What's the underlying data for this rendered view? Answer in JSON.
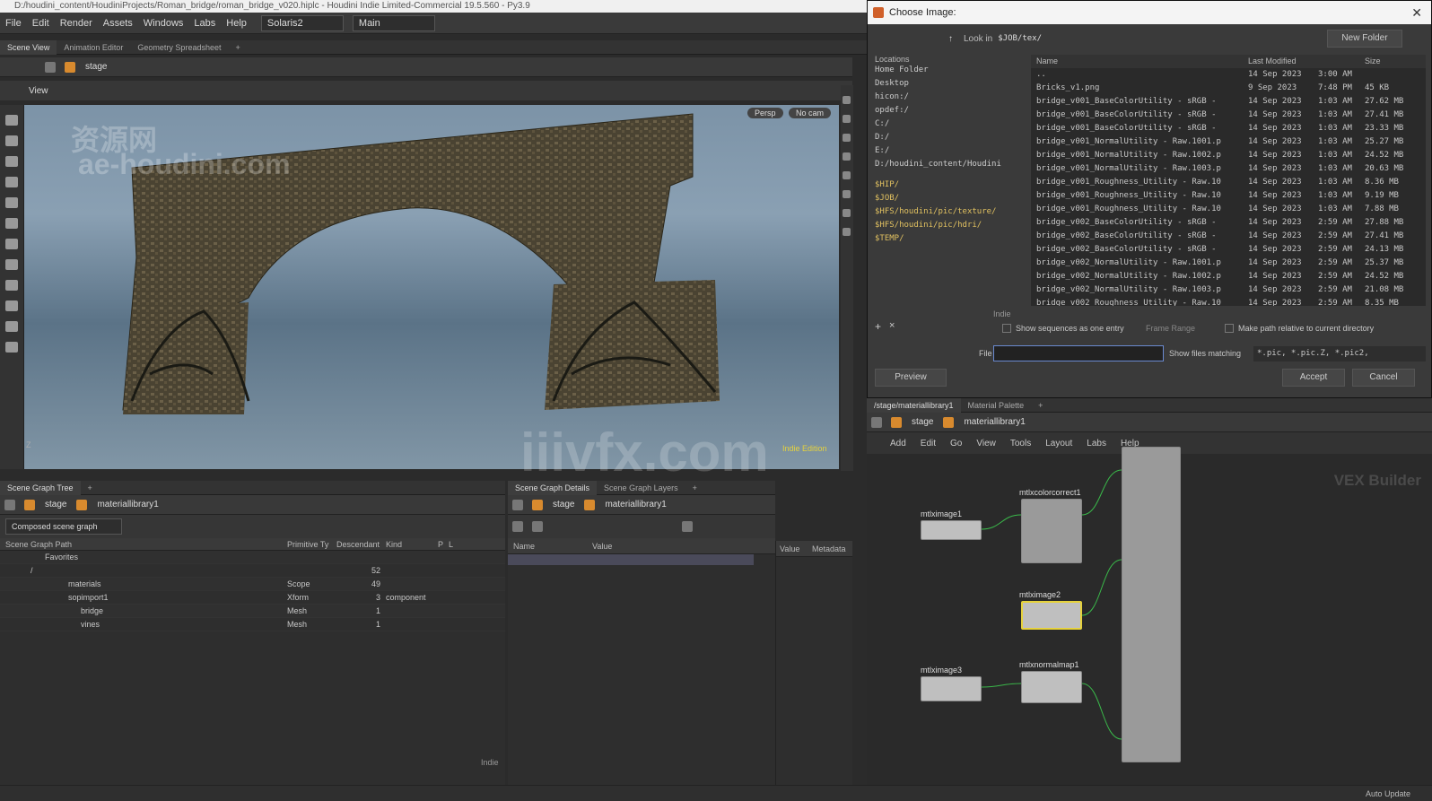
{
  "app": {
    "title": "D:/houdini_content/HoudiniProjects/Roman_bridge/roman_bridge_v020.hiplc - Houdini Indie Limited-Commercial 19.5.560 - Py3.9",
    "menu": [
      "File",
      "Edit",
      "Render",
      "Assets",
      "Windows",
      "Labs",
      "Help"
    ],
    "desktop": "Solaris2",
    "context": "Main"
  },
  "top_tabs": [
    "Scene View",
    "Animation Editor",
    "Geometry Spreadsheet"
  ],
  "stage_path": "stage",
  "viewport": {
    "label": "View",
    "persp": "Persp",
    "cam": "No cam",
    "watermark_top": "资源网",
    "watermark_bottom": "ae-houdini.com",
    "center_watermark": "iiivfx.com",
    "indie_label": "Indie Edition"
  },
  "scene_graph_tree": {
    "tab": "Scene Graph Tree",
    "path_stage": "stage",
    "path_node": "materiallibrary1",
    "mode": "Composed scene graph",
    "columns": [
      "Scene Graph Path",
      "Primitive Ty",
      "Descendant",
      "Kind",
      "P",
      "L"
    ],
    "rows": [
      {
        "name": "Favorites",
        "type": "",
        "desc": "",
        "kind": ""
      },
      {
        "name": "/",
        "type": "",
        "desc": "52",
        "kind": ""
      },
      {
        "name": "materials",
        "type": "Scope",
        "desc": "49",
        "kind": ""
      },
      {
        "name": "sopimport1",
        "type": "Xform",
        "desc": "3",
        "kind": "component"
      },
      {
        "name": "bridge",
        "type": "Mesh",
        "desc": "1",
        "kind": ""
      },
      {
        "name": "vines",
        "type": "Mesh",
        "desc": "1",
        "kind": ""
      }
    ],
    "footer": "Indie"
  },
  "scene_graph_details": {
    "tabs": [
      "Scene Graph Details",
      "Scene Graph Layers"
    ],
    "path_stage": "stage",
    "path_node": "materiallibrary1",
    "col_name": "Name",
    "col_value": "Value",
    "side_value": "Value",
    "side_meta": "Metadata"
  },
  "dialog": {
    "title": "Choose Image:",
    "look_in_label": "Look in",
    "look_in": "$JOB/tex/",
    "new_folder": "New Folder",
    "locations_label": "Locations",
    "locations": [
      "Home Folder",
      "Desktop",
      "hicon:/",
      "opdef:/",
      "C:/",
      "D:/",
      "E:/",
      "D:/houdini_content/Houdini"
    ],
    "folders": [
      "$HIP/",
      "$JOB/",
      "$HFS/houdini/pic/texture/",
      "$HFS/houdini/pic/hdri/",
      "$TEMP/"
    ],
    "columns": [
      "Name",
      "Last Modified",
      "Size"
    ],
    "files": [
      {
        "name": "..",
        "date": "14 Sep 2023",
        "time": "3:00 AM",
        "size": ""
      },
      {
        "name": "Bricks_v1.png",
        "date": "9 Sep 2023",
        "time": "7:48 PM",
        "size": "45 KB"
      },
      {
        "name": "bridge_v001_BaseColorUtility - sRGB -",
        "date": "14 Sep 2023",
        "time": "1:03 AM",
        "size": "27.62 MB"
      },
      {
        "name": "bridge_v001_BaseColorUtility - sRGB -",
        "date": "14 Sep 2023",
        "time": "1:03 AM",
        "size": "27.41 MB"
      },
      {
        "name": "bridge_v001_BaseColorUtility - sRGB -",
        "date": "14 Sep 2023",
        "time": "1:03 AM",
        "size": "23.33 MB"
      },
      {
        "name": "bridge_v001_NormalUtility - Raw.1001.p",
        "date": "14 Sep 2023",
        "time": "1:03 AM",
        "size": "25.27 MB"
      },
      {
        "name": "bridge_v001_NormalUtility - Raw.1002.p",
        "date": "14 Sep 2023",
        "time": "1:03 AM",
        "size": "24.52 MB"
      },
      {
        "name": "bridge_v001_NormalUtility - Raw.1003.p",
        "date": "14 Sep 2023",
        "time": "1:03 AM",
        "size": "20.63 MB"
      },
      {
        "name": "bridge_v001_Roughness_Utility - Raw.10",
        "date": "14 Sep 2023",
        "time": "1:03 AM",
        "size": "8.36 MB"
      },
      {
        "name": "bridge_v001_Roughness_Utility - Raw.10",
        "date": "14 Sep 2023",
        "time": "1:03 AM",
        "size": "9.19 MB"
      },
      {
        "name": "bridge_v001_Roughness_Utility - Raw.10",
        "date": "14 Sep 2023",
        "time": "1:03 AM",
        "size": "7.88 MB"
      },
      {
        "name": "bridge_v002_BaseColorUtility - sRGB -",
        "date": "14 Sep 2023",
        "time": "2:59 AM",
        "size": "27.88 MB"
      },
      {
        "name": "bridge_v002_BaseColorUtility - sRGB -",
        "date": "14 Sep 2023",
        "time": "2:59 AM",
        "size": "27.41 MB"
      },
      {
        "name": "bridge_v002_BaseColorUtility - sRGB -",
        "date": "14 Sep 2023",
        "time": "2:59 AM",
        "size": "24.13 MB"
      },
      {
        "name": "bridge_v002_NormalUtility - Raw.1001.p",
        "date": "14 Sep 2023",
        "time": "2:59 AM",
        "size": "25.37 MB"
      },
      {
        "name": "bridge_v002_NormalUtility - Raw.1002.p",
        "date": "14 Sep 2023",
        "time": "2:59 AM",
        "size": "24.52 MB"
      },
      {
        "name": "bridge_v002_NormalUtility - Raw.1003.p",
        "date": "14 Sep 2023",
        "time": "2:59 AM",
        "size": "21.08 MB"
      },
      {
        "name": "bridge_v002_Roughness_Utility - Raw.10",
        "date": "14 Sep 2023",
        "time": "2:59 AM",
        "size": "8.35 MB"
      }
    ],
    "indie": "Indie",
    "show_sequences": "Show sequences as one entry",
    "frame_range": "Frame Range",
    "make_relative": "Make path relative to current directory",
    "file_label": "File",
    "file_value": "",
    "show_matching_label": "Show files matching",
    "show_matching_value": "*.pic, *.pic.Z, *.pic2,",
    "preview": "Preview",
    "accept": "Accept",
    "cancel": "Cancel"
  },
  "material_pane": {
    "tabs": [
      "/stage/materiallibrary1",
      "Material Palette"
    ],
    "path_stage": "stage",
    "path_node": "materiallibrary1",
    "menu": [
      "Add",
      "Edit",
      "Go",
      "View",
      "Tools",
      "Layout",
      "Labs",
      "Help"
    ],
    "context_label": "VEX Builder",
    "nodes": [
      "mtlximage1",
      "mtlxcolorcorrect1",
      "mtlximage2",
      "mtlximage3",
      "mtlxnormalmap1"
    ]
  },
  "status": {
    "auto_update": "Auto Update"
  },
  "colors": {
    "accent": "#e6d23c",
    "dialog_title_bg": "#f4f4f4"
  }
}
